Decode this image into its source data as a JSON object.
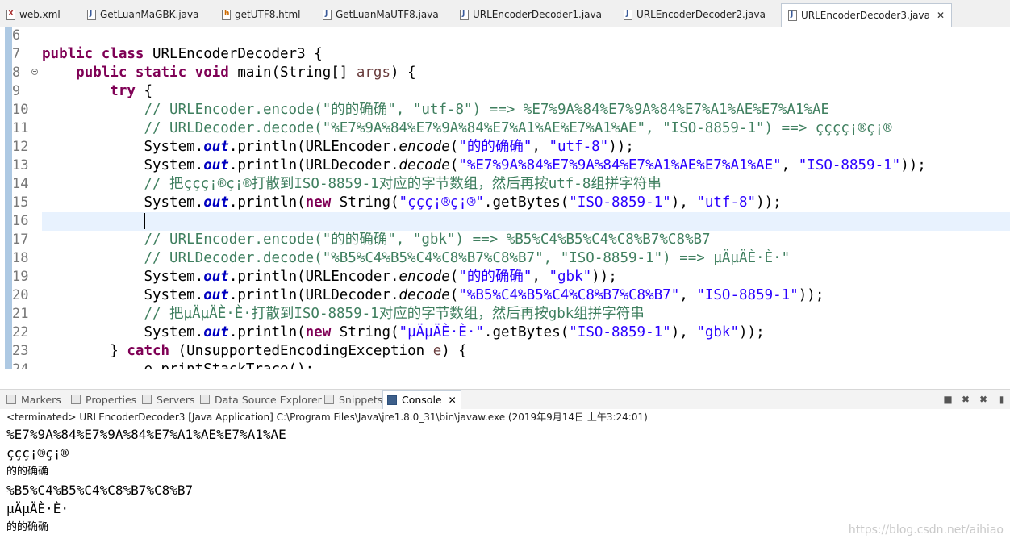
{
  "editor_tabs": [
    {
      "label": "web.xml",
      "icon": "xml-file-icon"
    },
    {
      "label": "GetLuanMaGBK.java",
      "icon": "java-file-icon"
    },
    {
      "label": "getUTF8.html",
      "icon": "html-file-icon"
    },
    {
      "label": "GetLuanMaUTF8.java",
      "icon": "java-file-icon"
    },
    {
      "label": "URLEncoderDecoder1.java",
      "icon": "java-file-icon"
    },
    {
      "label": "URLEncoderDecoder2.java",
      "icon": "java-file-icon"
    },
    {
      "label": "URLEncoderDecoder3.java",
      "icon": "java-file-icon",
      "active": true,
      "close": "✕"
    }
  ],
  "line_numbers": [
    "6",
    "7",
    "8",
    "9",
    "10",
    "11",
    "12",
    "13",
    "14",
    "15",
    "16",
    "17",
    "18",
    "19",
    "20",
    "21",
    "22",
    "23",
    "24"
  ],
  "code": {
    "l7": {
      "kw": "public class",
      "rest": " URLEncoderDecoder3 {"
    },
    "l8": {
      "kw": "public static void",
      "a": " main(String[] ",
      "var": "args",
      "b": ") {"
    },
    "l9": {
      "kw": "try",
      "rest": " {"
    },
    "l10": "// URLEncoder.encode(\"的的确确\", \"utf-8\") ==> %E7%9A%84%E7%9A%84%E7%A1%AE%E7%A1%AE",
    "l11": "// URLDecoder.decode(\"%E7%9A%84%E7%9A%84%E7%A1%AE%E7%A1%AE\", \"ISO-8859-1\") ==> çççç¡®ç¡®",
    "l12": {
      "a": "System.",
      "fd": "out",
      "b": ".println(URLEncoder.",
      "mt": "encode",
      "c": "(",
      "s1": "\"的的确确\"",
      "d": ", ",
      "s2": "\"utf-8\"",
      "e": "));"
    },
    "l13": {
      "a": "System.",
      "fd": "out",
      "b": ".println(URLDecoder.",
      "mt": "decode",
      "c": "(",
      "s1": "\"%E7%9A%84%E7%9A%84%E7%A1%AE%E7%A1%AE\"",
      "d": ", ",
      "s2": "\"ISO-8859-1\"",
      "e": "));"
    },
    "l14": "// 把ççç¡®ç¡®打散到ISO-8859-1对应的字节数组，然后再按utf-8组拼字符串",
    "l15": {
      "a": "System.",
      "fd": "out",
      "b": ".println(",
      "kw": "new",
      "c": " String(",
      "s1": "\"ççç¡®ç¡®\"",
      "d": ".getBytes(",
      "s2": "\"ISO-8859-1\"",
      "e": "), ",
      "s3": "\"utf-8\"",
      "f": "));"
    },
    "l17": "// URLEncoder.encode(\"的的确确\", \"gbk\") ==> %B5%C4%B5%C4%C8%B7%C8%B7",
    "l18": "// URLDecoder.decode(\"%B5%C4%B5%C4%C8%B7%C8%B7\", \"ISO-8859-1\") ==> µÄµÄÈ·È·\"",
    "l19": {
      "a": "System.",
      "fd": "out",
      "b": ".println(URLEncoder.",
      "mt": "encode",
      "c": "(",
      "s1": "\"的的确确\"",
      "d": ", ",
      "s2": "\"gbk\"",
      "e": "));"
    },
    "l20": {
      "a": "System.",
      "fd": "out",
      "b": ".println(URLDecoder.",
      "mt": "decode",
      "c": "(",
      "s1": "\"%B5%C4%B5%C4%C8%B7%C8%B7\"",
      "d": ", ",
      "s2": "\"ISO-8859-1\"",
      "e": "));"
    },
    "l21": "// 把µÄµÄÈ·È·打散到ISO-8859-1对应的字节数组，然后再按gbk组拼字符串",
    "l22": {
      "a": "System.",
      "fd": "out",
      "b": ".println(",
      "kw": "new",
      "c": " String(",
      "s1": "\"µÄµÄÈ·È·\"",
      "d": ".getBytes(",
      "s2": "\"ISO-8859-1\"",
      "e": "), ",
      "s3": "\"gbk\"",
      "f": "));"
    },
    "l23": {
      "a": "} ",
      "kw": "catch",
      "b": " (UnsupportedEncodingException ",
      "var": "e",
      "c": ") {"
    },
    "l24": "e.printStackTrace();"
  },
  "views": [
    {
      "label": "Markers",
      "icon": "markers-icon"
    },
    {
      "label": "Properties",
      "icon": "properties-icon"
    },
    {
      "label": "Servers",
      "icon": "servers-icon"
    },
    {
      "label": "Data Source Explorer",
      "icon": "data-source-icon"
    },
    {
      "label": "Snippets",
      "icon": "snippets-icon"
    },
    {
      "label": "Console",
      "icon": "console-icon",
      "active": true,
      "close": "✕"
    }
  ],
  "console": {
    "header": "<terminated> URLEncoderDecoder3 [Java Application] C:\\Program Files\\Java\\jre1.8.0_31\\bin\\javaw.exe (2019年9月14日 上午3:24:01)",
    "lines": [
      "%E7%9A%84%E7%9A%84%E7%A1%AE%E7%A1%AE",
      "ççç¡®ç¡®",
      "的的确确",
      "%B5%C4%B5%C4%C8%B7%C8%B7",
      "µÄµÄÈ·È·",
      "的的确确"
    ]
  },
  "watermark": "https://blog.csdn.net/aihiao",
  "colors": {
    "keyword": "#7f0055",
    "comment": "#3f7f5f",
    "string": "#2a00ff",
    "field": "#0000c0",
    "current_line": "#e8f2fe"
  }
}
